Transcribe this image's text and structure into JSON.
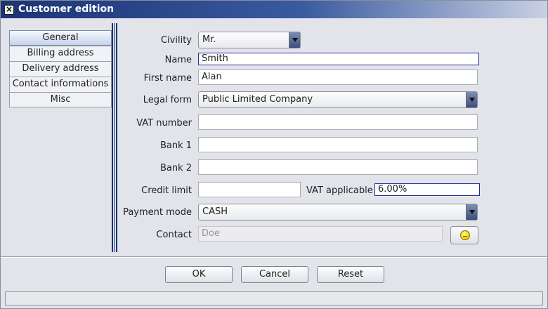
{
  "window": {
    "title": "Customer edition"
  },
  "tabs": [
    {
      "label": "General",
      "active": true
    },
    {
      "label": "Billing address",
      "active": false
    },
    {
      "label": "Delivery address",
      "active": false
    },
    {
      "label": "Contact informations",
      "active": false
    },
    {
      "label": "Misc",
      "active": false
    }
  ],
  "form": {
    "civility": {
      "label": "Civility",
      "value": "Mr."
    },
    "name": {
      "label": "Name",
      "value": "Smith"
    },
    "first_name": {
      "label": "First name",
      "value": "Alan"
    },
    "legal_form": {
      "label": "Legal form",
      "value": "Public Limited Company"
    },
    "vat_number": {
      "label": "VAT number",
      "value": ""
    },
    "bank1": {
      "label": "Bank 1",
      "value": ""
    },
    "bank2": {
      "label": "Bank 2",
      "value": ""
    },
    "credit_limit": {
      "label": "Credit limit",
      "value": ""
    },
    "vat_applicable": {
      "label": "VAT applicable",
      "value": "6.00%"
    },
    "payment_mode": {
      "label": "Payment mode",
      "value": "CASH"
    },
    "contact": {
      "label": "Contact",
      "value": "Doe",
      "icon": "lightbulb-icon"
    }
  },
  "buttons": {
    "ok": "OK",
    "cancel": "Cancel",
    "reset": "Reset"
  }
}
